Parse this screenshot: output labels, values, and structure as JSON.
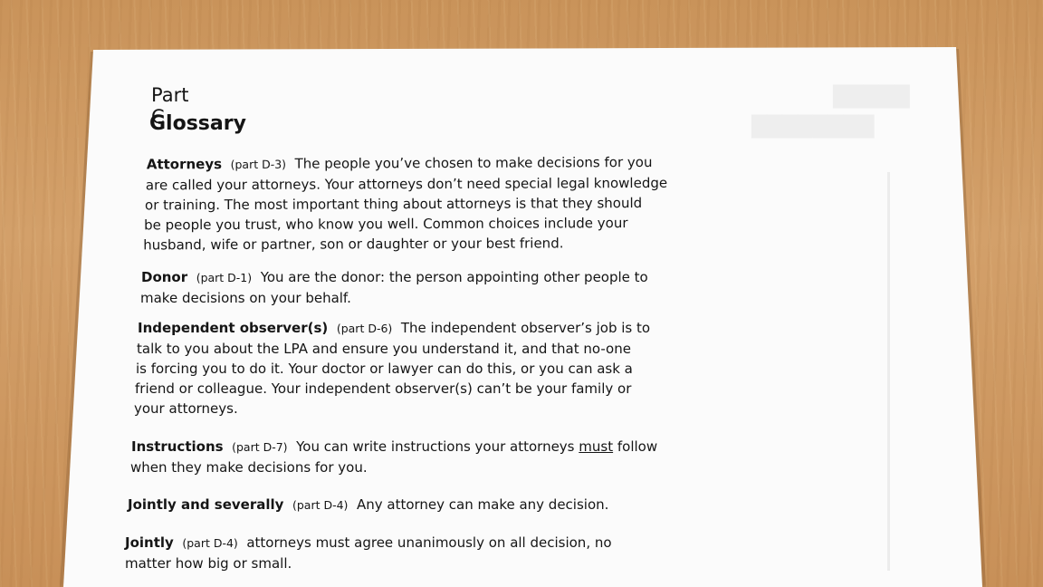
{
  "doc": {
    "part_label": "Part C",
    "title": "Glossary",
    "entries": [
      {
        "term": "Attorneys",
        "ref": "(part D-3)",
        "lines": [
          "The people you’ve chosen to make decisions for you",
          "are called your attorneys. Your attorneys don’t need special legal knowledge",
          "or training. The most important thing about attorneys is that they should",
          "be people you trust, who know you well. Common choices include your",
          "husband, wife or partner, son or daughter or your best friend."
        ]
      },
      {
        "term": "Donor",
        "ref": "(part D-1)",
        "lines": [
          "You are the donor: the person appointing other people to",
          "make decisions on your behalf."
        ]
      },
      {
        "term": "Independent observer(s)",
        "ref": "(part D-6)",
        "lines": [
          "The independent observer’s job is to",
          "talk to you about the LPA and ensure you understand it, and that no-one",
          "is forcing you to do it. Your doctor or lawyer can do this, or you can ask a",
          "friend or colleague. Your independent observer(s) can’t be your family or",
          "your attorneys."
        ]
      },
      {
        "term": "Instructions",
        "ref": "(part D-7)",
        "line1_before": "You can write instructions your attorneys",
        "line1_must": "must",
        "line1_after": "follow",
        "lines": [
          "when they make decisions for you."
        ]
      },
      {
        "term": "Jointly and severally",
        "ref": "(part D-4)",
        "lines": [
          "Any attorney can make any decision."
        ]
      },
      {
        "term": "Jointly",
        "ref": "(part D-4)",
        "lines": [
          "attorneys must agree unanimously on all decision, no",
          "matter how big or small."
        ]
      }
    ]
  }
}
